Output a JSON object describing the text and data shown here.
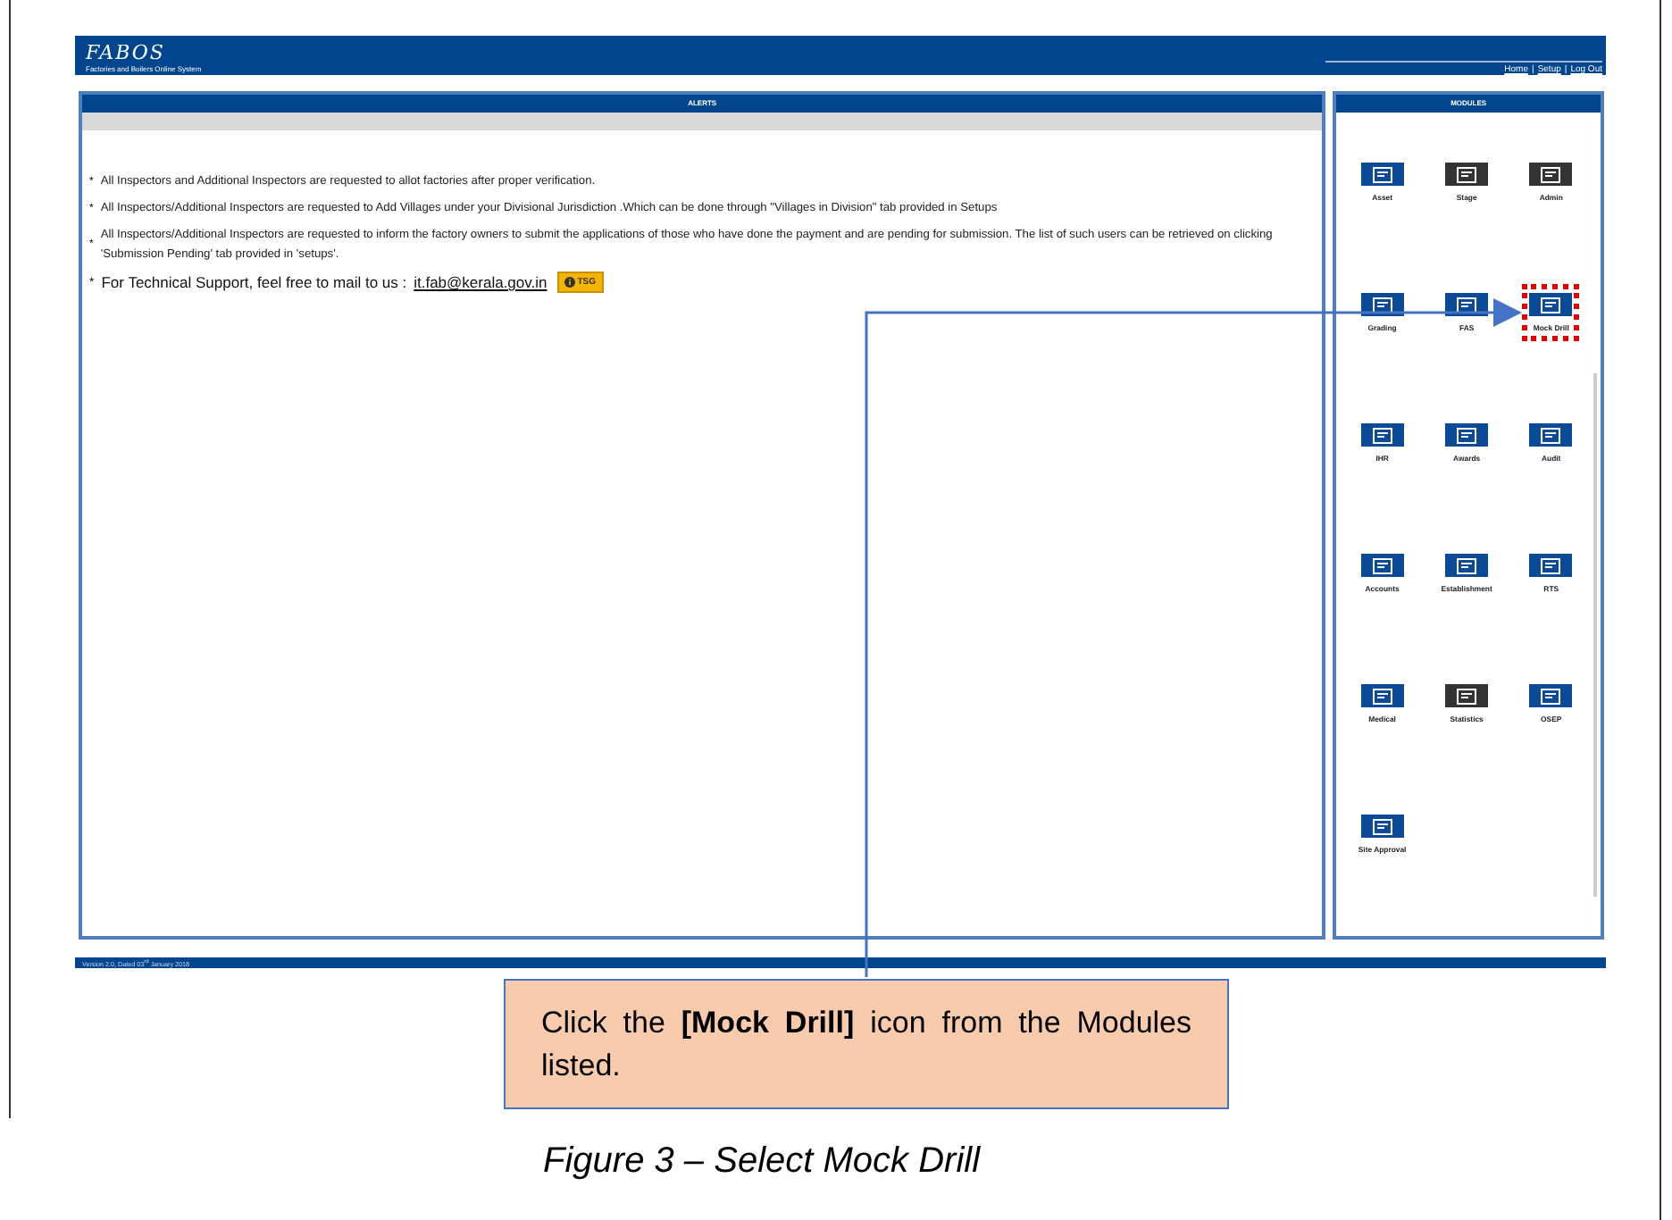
{
  "header": {
    "logo": "FABOS",
    "subtitle": "Factories and Boilers Online System",
    "nav": [
      "Home",
      "Setup",
      "Log Out"
    ],
    "nav_separator": "|"
  },
  "alerts": {
    "title": "ALERTS",
    "bullet": "*",
    "items": [
      {
        "kind": "note",
        "text": "All Inspectors and Additional Inspectors are requested to allot factories after proper verification."
      },
      {
        "kind": "note",
        "text": "All Inspectors/Additional Inspectors are requested to Add Villages under your Divisional Jurisdiction .Which can be done through \"Villages in Division\" tab provided in Setups"
      },
      {
        "kind": "note",
        "text": "All Inspectors/Additional Inspectors are requested to inform the factory owners to submit the applications of those who have done the payment and are pending for submission. The list of such users can be retrieved on clicking 'Submission Pending' tab provided in 'setups'."
      },
      {
        "kind": "support",
        "text": "For Technical Support, feel free to mail to us :",
        "link": "it.fab@kerala.gov.in",
        "button": "TSG"
      }
    ]
  },
  "modules": {
    "title": "MODULES",
    "items": [
      {
        "label": "Asset",
        "color": "#0b4a96",
        "highlighted": false
      },
      {
        "label": "Stage",
        "color": "#333333",
        "highlighted": false
      },
      {
        "label": "Admin",
        "color": "#333333",
        "highlighted": false
      },
      {
        "label": "Grading",
        "color": "#0b4a96",
        "highlighted": false
      },
      {
        "label": "FAS",
        "color": "#0b4a96",
        "highlighted": false
      },
      {
        "label": "Mock Drill",
        "color": "#0b4a96",
        "highlighted": true
      },
      {
        "label": "IHR",
        "color": "#0b4a96",
        "highlighted": false
      },
      {
        "label": "Awards",
        "color": "#0b4a96",
        "highlighted": false
      },
      {
        "label": "Audit",
        "color": "#0b4a96",
        "highlighted": false
      },
      {
        "label": "Accounts",
        "color": "#0b4a96",
        "highlighted": false
      },
      {
        "label": "Establishment",
        "color": "#0b4a96",
        "highlighted": false
      },
      {
        "label": "RTS",
        "color": "#0b4a96",
        "highlighted": false
      },
      {
        "label": "Medical",
        "color": "#0b4a96",
        "highlighted": false
      },
      {
        "label": "Statistics",
        "color": "#333333",
        "highlighted": false
      },
      {
        "label": "OSEP",
        "color": "#0b4a96",
        "highlighted": false
      },
      {
        "label": "Site Approval",
        "color": "#0b4a96",
        "highlighted": false
      }
    ]
  },
  "footer": "Version 2.0, Dated 03$^{rd}$ January 2018",
  "callout": "Click the **[Mock Drill]** icon from the Modules listed.",
  "caption": "Figure 3 – Select Mock Drill"
}
